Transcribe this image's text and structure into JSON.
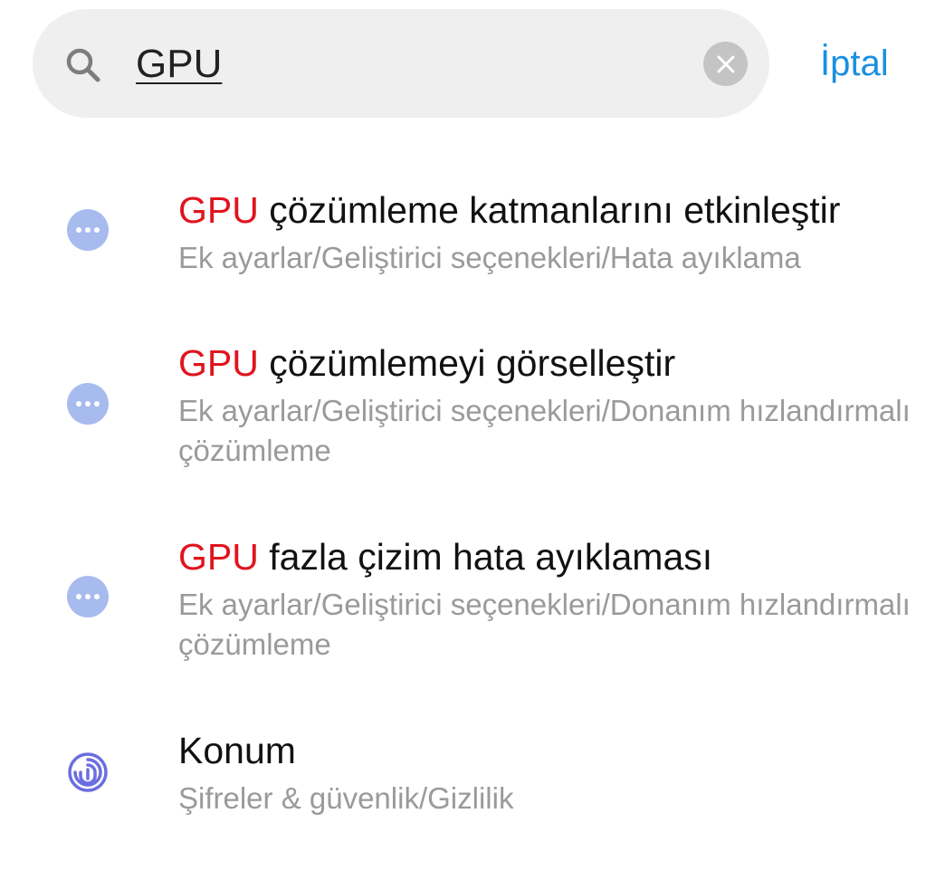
{
  "search": {
    "query": "GPU",
    "cancel_label": "İptal"
  },
  "colors": {
    "highlight": "#e0141e",
    "accent": "#1a8fe0",
    "subtitle": "#9a9a9a",
    "dots_icon_bg": "#a8bbef",
    "fingerprint_icon": "#6b6ee0"
  },
  "results": [
    {
      "icon": "more-dots-icon",
      "title_highlight": "GPU",
      "title_rest": " çözümleme katmanlarını etkinleştir",
      "subtitle": "Ek ayarlar/Geliştirici seçenekleri/Hata ayıklama"
    },
    {
      "icon": "more-dots-icon",
      "title_highlight": "GPU",
      "title_rest": " çözümlemeyi görselleştir",
      "subtitle": "Ek ayarlar/Geliştirici seçenekleri/Donanım hızlandırmalı çözümleme"
    },
    {
      "icon": "more-dots-icon",
      "title_highlight": "GPU",
      "title_rest": " fazla çizim hata ayıklaması",
      "subtitle": "Ek ayarlar/Geliştirici seçenekleri/Donanım hızlandırmalı çözümleme"
    },
    {
      "icon": "fingerprint-icon",
      "title_highlight": "",
      "title_rest": "Konum",
      "subtitle": "Şifreler & güvenlik/Gizlilik"
    }
  ]
}
